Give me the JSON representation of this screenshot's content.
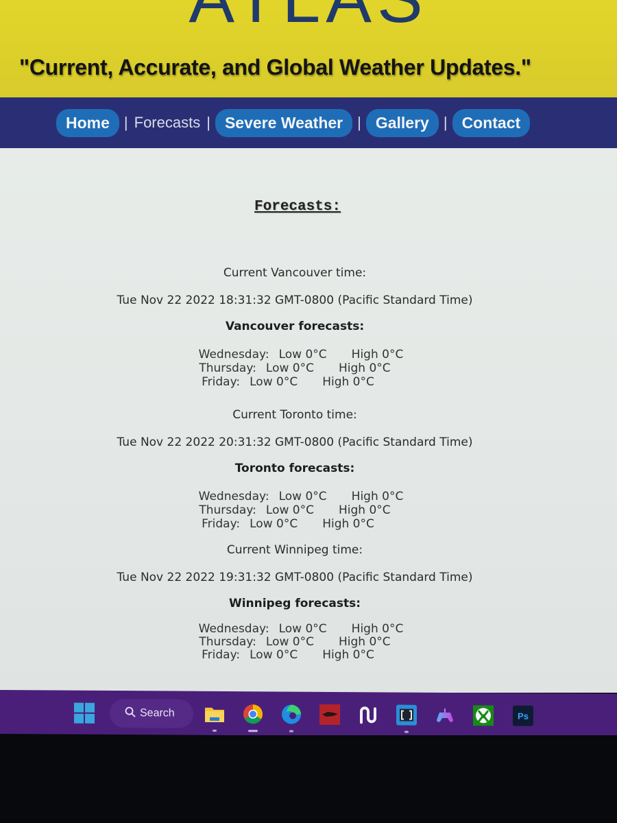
{
  "header": {
    "logo_text": "ATLAS",
    "tagline": "\"Current, Accurate, and Global Weather Updates.\""
  },
  "nav": {
    "items": [
      {
        "label": "Home",
        "style": "pill"
      },
      {
        "label": "Forecasts",
        "style": "plain",
        "active": true
      },
      {
        "label": "Severe Weather",
        "style": "pill"
      },
      {
        "label": "Gallery",
        "style": "pill"
      },
      {
        "label": "Contact",
        "style": "pill"
      }
    ],
    "separator": "|"
  },
  "page": {
    "heading": "Forecasts:"
  },
  "cities": [
    {
      "name": "Vancouver",
      "time_label": "Current Vancouver time:",
      "time_value": "Tue Nov 22 2022 18:31:32 GMT-0800 (Pacific Standard Time)",
      "forecast_title": "Vancouver forecasts:",
      "forecasts": [
        {
          "day": "Wednesday:",
          "low": "Low 0°C",
          "high": "High 0°C"
        },
        {
          "day": "Thursday:",
          "low": "Low 0°C",
          "high": "High 0°C"
        },
        {
          "day": "Friday:",
          "low": "Low 0°C",
          "high": "High 0°C"
        }
      ]
    },
    {
      "name": "Toronto",
      "time_label": "Current Toronto time:",
      "time_value": "Tue Nov 22 2022 20:31:32 GMT-0800 (Pacific Standard Time)",
      "forecast_title": "Toronto forecasts:",
      "forecasts": [
        {
          "day": "Wednesday:",
          "low": "Low 0°C",
          "high": "High 0°C"
        },
        {
          "day": "Thursday:",
          "low": "Low 0°C",
          "high": "High 0°C"
        },
        {
          "day": "Friday:",
          "low": "Low 0°C",
          "high": "High 0°C"
        }
      ]
    },
    {
      "name": "Winnipeg",
      "time_label": "Current Winnipeg time:",
      "time_value": "Tue Nov 22 2022 19:31:32 GMT-0800 (Pacific Standard Time)",
      "forecast_title": "Winnipeg forecasts:",
      "forecasts": [
        {
          "day": "Wednesday:",
          "low": "Low 0°C",
          "high": "High 0°C"
        },
        {
          "day": "Thursday:",
          "low": "Low 0°C",
          "high": "High 0°C"
        },
        {
          "day": "Friday:",
          "low": "Low 0°C",
          "high": "High 0°C"
        }
      ]
    }
  ],
  "taskbar": {
    "search_label": "Search",
    "search_icon": "magnifier-icon",
    "apps": [
      {
        "name": "start",
        "icon": "windows-start-icon"
      },
      {
        "name": "file-explorer",
        "icon": "folder-icon",
        "running": true
      },
      {
        "name": "chrome",
        "icon": "chrome-icon",
        "running": true,
        "active": true
      },
      {
        "name": "edge",
        "icon": "edge-icon",
        "running": true
      },
      {
        "name": "red-app",
        "icon": "red-app-icon"
      },
      {
        "name": "wave-app",
        "icon": "wave-app-icon"
      },
      {
        "name": "brackets",
        "icon": "brackets-icon",
        "running": true
      },
      {
        "name": "game-controller",
        "icon": "gamepad-icon"
      },
      {
        "name": "xbox",
        "icon": "xbox-icon"
      },
      {
        "name": "photoshop",
        "icon": "photoshop-icon",
        "label": "Ps"
      }
    ]
  },
  "colors": {
    "header_bg": "#dccf2a",
    "logo": "#1f3a6b",
    "nav_bg": "#2a2f75",
    "nav_pill": "#1f6db7",
    "content_bg": "#e4e8e6",
    "taskbar_bg": "#4a1f7a"
  }
}
